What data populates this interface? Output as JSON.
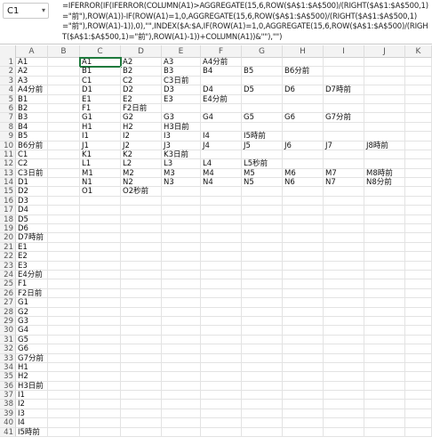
{
  "formula_bar": {
    "name_box": "C1",
    "formula": "=IFERROR(IF(IFERROR(COLUMN(A1)>AGGREGATE(15,6,ROW($A$1:$A$500)/(RIGHT($A$1:$A$500,1)=\"前\"),ROW(A1))-IF(ROW(A1)=1,0,AGGREGATE(15,6,ROW($A$1:$A$500)/(RIGHT($A$1:$A$500,1)=\"前\"),ROW(A1)-1)),0),\"\",INDEX($A:$A,IF(ROW(A1)=1,0,AGGREGATE(15,6,ROW($A$1:$A$500)/(RIGHT($A$1:$A$500,1)=\"前\"),ROW(A1)-1))+COLUMN(A1))&\"\"),\"\")"
  },
  "columns": [
    "A",
    "B",
    "C",
    "D",
    "E",
    "F",
    "G",
    "H",
    "I",
    "J",
    "K"
  ],
  "rows": [
    {
      "n": "1",
      "cells": [
        "A1",
        "",
        "A1",
        "A2",
        "A3",
        "A4分前",
        "",
        "",
        "",
        "",
        ""
      ]
    },
    {
      "n": "2",
      "cells": [
        "A2",
        "",
        "B1",
        "B2",
        "B3",
        "B4",
        "B5",
        "B6分前",
        "",
        "",
        ""
      ]
    },
    {
      "n": "3",
      "cells": [
        "A3",
        "",
        "C1",
        "C2",
        "C3日前",
        "",
        "",
        "",
        "",
        "",
        ""
      ]
    },
    {
      "n": "4",
      "cells": [
        "A4分前",
        "",
        "D1",
        "D2",
        "D3",
        "D4",
        "D5",
        "D6",
        "D7時前",
        "",
        ""
      ]
    },
    {
      "n": "5",
      "cells": [
        "B1",
        "",
        "E1",
        "E2",
        "E3",
        "E4分前",
        "",
        "",
        "",
        "",
        ""
      ]
    },
    {
      "n": "6",
      "cells": [
        "B2",
        "",
        "F1",
        "F2日前",
        "",
        "",
        "",
        "",
        "",
        "",
        ""
      ]
    },
    {
      "n": "7",
      "cells": [
        "B3",
        "",
        "G1",
        "G2",
        "G3",
        "G4",
        "G5",
        "G6",
        "G7分前",
        "",
        ""
      ]
    },
    {
      "n": "8",
      "cells": [
        "B4",
        "",
        "H1",
        "H2",
        "H3日前",
        "",
        "",
        "",
        "",
        "",
        ""
      ]
    },
    {
      "n": "9",
      "cells": [
        "B5",
        "",
        "I1",
        "I2",
        "I3",
        "I4",
        "I5時前",
        "",
        "",
        "",
        ""
      ]
    },
    {
      "n": "10",
      "cells": [
        "B6分前",
        "",
        "J1",
        "J2",
        "J3",
        "J4",
        "J5",
        "J6",
        "J7",
        "J8時前",
        ""
      ]
    },
    {
      "n": "11",
      "cells": [
        "C1",
        "",
        "K1",
        "K2",
        "K3日前",
        "",
        "",
        "",
        "",
        "",
        ""
      ]
    },
    {
      "n": "12",
      "cells": [
        "C2",
        "",
        "L1",
        "L2",
        "L3",
        "L4",
        "L5秒前",
        "",
        "",
        "",
        ""
      ]
    },
    {
      "n": "13",
      "cells": [
        "C3日前",
        "",
        "M1",
        "M2",
        "M3",
        "M4",
        "M5",
        "M6",
        "M7",
        "M8時前",
        ""
      ]
    },
    {
      "n": "14",
      "cells": [
        "D1",
        "",
        "N1",
        "N2",
        "N3",
        "N4",
        "N5",
        "N6",
        "N7",
        "N8分前",
        ""
      ]
    },
    {
      "n": "15",
      "cells": [
        "D2",
        "",
        "O1",
        "O2秒前",
        "",
        "",
        "",
        "",
        "",
        "",
        ""
      ]
    },
    {
      "n": "16",
      "cells": [
        "D3",
        "",
        "",
        "",
        "",
        "",
        "",
        "",
        "",
        "",
        ""
      ]
    },
    {
      "n": "17",
      "cells": [
        "D4",
        "",
        "",
        "",
        "",
        "",
        "",
        "",
        "",
        "",
        ""
      ]
    },
    {
      "n": "18",
      "cells": [
        "D5",
        "",
        "",
        "",
        "",
        "",
        "",
        "",
        "",
        "",
        ""
      ]
    },
    {
      "n": "19",
      "cells": [
        "D6",
        "",
        "",
        "",
        "",
        "",
        "",
        "",
        "",
        "",
        ""
      ]
    },
    {
      "n": "20",
      "cells": [
        "D7時前",
        "",
        "",
        "",
        "",
        "",
        "",
        "",
        "",
        "",
        ""
      ]
    },
    {
      "n": "21",
      "cells": [
        "E1",
        "",
        "",
        "",
        "",
        "",
        "",
        "",
        "",
        "",
        ""
      ]
    },
    {
      "n": "22",
      "cells": [
        "E2",
        "",
        "",
        "",
        "",
        "",
        "",
        "",
        "",
        "",
        ""
      ]
    },
    {
      "n": "23",
      "cells": [
        "E3",
        "",
        "",
        "",
        "",
        "",
        "",
        "",
        "",
        "",
        ""
      ]
    },
    {
      "n": "24",
      "cells": [
        "E4分前",
        "",
        "",
        "",
        "",
        "",
        "",
        "",
        "",
        "",
        ""
      ]
    },
    {
      "n": "25",
      "cells": [
        "F1",
        "",
        "",
        "",
        "",
        "",
        "",
        "",
        "",
        "",
        ""
      ]
    },
    {
      "n": "26",
      "cells": [
        "F2日前",
        "",
        "",
        "",
        "",
        "",
        "",
        "",
        "",
        "",
        ""
      ]
    },
    {
      "n": "27",
      "cells": [
        "G1",
        "",
        "",
        "",
        "",
        "",
        "",
        "",
        "",
        "",
        ""
      ]
    },
    {
      "n": "28",
      "cells": [
        "G2",
        "",
        "",
        "",
        "",
        "",
        "",
        "",
        "",
        "",
        ""
      ]
    },
    {
      "n": "29",
      "cells": [
        "G3",
        "",
        "",
        "",
        "",
        "",
        "",
        "",
        "",
        "",
        ""
      ]
    },
    {
      "n": "30",
      "cells": [
        "G4",
        "",
        "",
        "",
        "",
        "",
        "",
        "",
        "",
        "",
        ""
      ]
    },
    {
      "n": "31",
      "cells": [
        "G5",
        "",
        "",
        "",
        "",
        "",
        "",
        "",
        "",
        "",
        ""
      ]
    },
    {
      "n": "32",
      "cells": [
        "G6",
        "",
        "",
        "",
        "",
        "",
        "",
        "",
        "",
        "",
        ""
      ]
    },
    {
      "n": "33",
      "cells": [
        "G7分前",
        "",
        "",
        "",
        "",
        "",
        "",
        "",
        "",
        "",
        ""
      ]
    },
    {
      "n": "34",
      "cells": [
        "H1",
        "",
        "",
        "",
        "",
        "",
        "",
        "",
        "",
        "",
        ""
      ]
    },
    {
      "n": "35",
      "cells": [
        "H2",
        "",
        "",
        "",
        "",
        "",
        "",
        "",
        "",
        "",
        ""
      ]
    },
    {
      "n": "36",
      "cells": [
        "H3日前",
        "",
        "",
        "",
        "",
        "",
        "",
        "",
        "",
        "",
        ""
      ]
    },
    {
      "n": "37",
      "cells": [
        "I1",
        "",
        "",
        "",
        "",
        "",
        "",
        "",
        "",
        "",
        ""
      ]
    },
    {
      "n": "38",
      "cells": [
        "I2",
        "",
        "",
        "",
        "",
        "",
        "",
        "",
        "",
        "",
        ""
      ]
    },
    {
      "n": "39",
      "cells": [
        "I3",
        "",
        "",
        "",
        "",
        "",
        "",
        "",
        "",
        "",
        ""
      ]
    },
    {
      "n": "40",
      "cells": [
        "I4",
        "",
        "",
        "",
        "",
        "",
        "",
        "",
        "",
        "",
        ""
      ]
    },
    {
      "n": "41",
      "cells": [
        "I5時前",
        "",
        "",
        "",
        "",
        "",
        "",
        "",
        "",
        "",
        ""
      ]
    }
  ]
}
